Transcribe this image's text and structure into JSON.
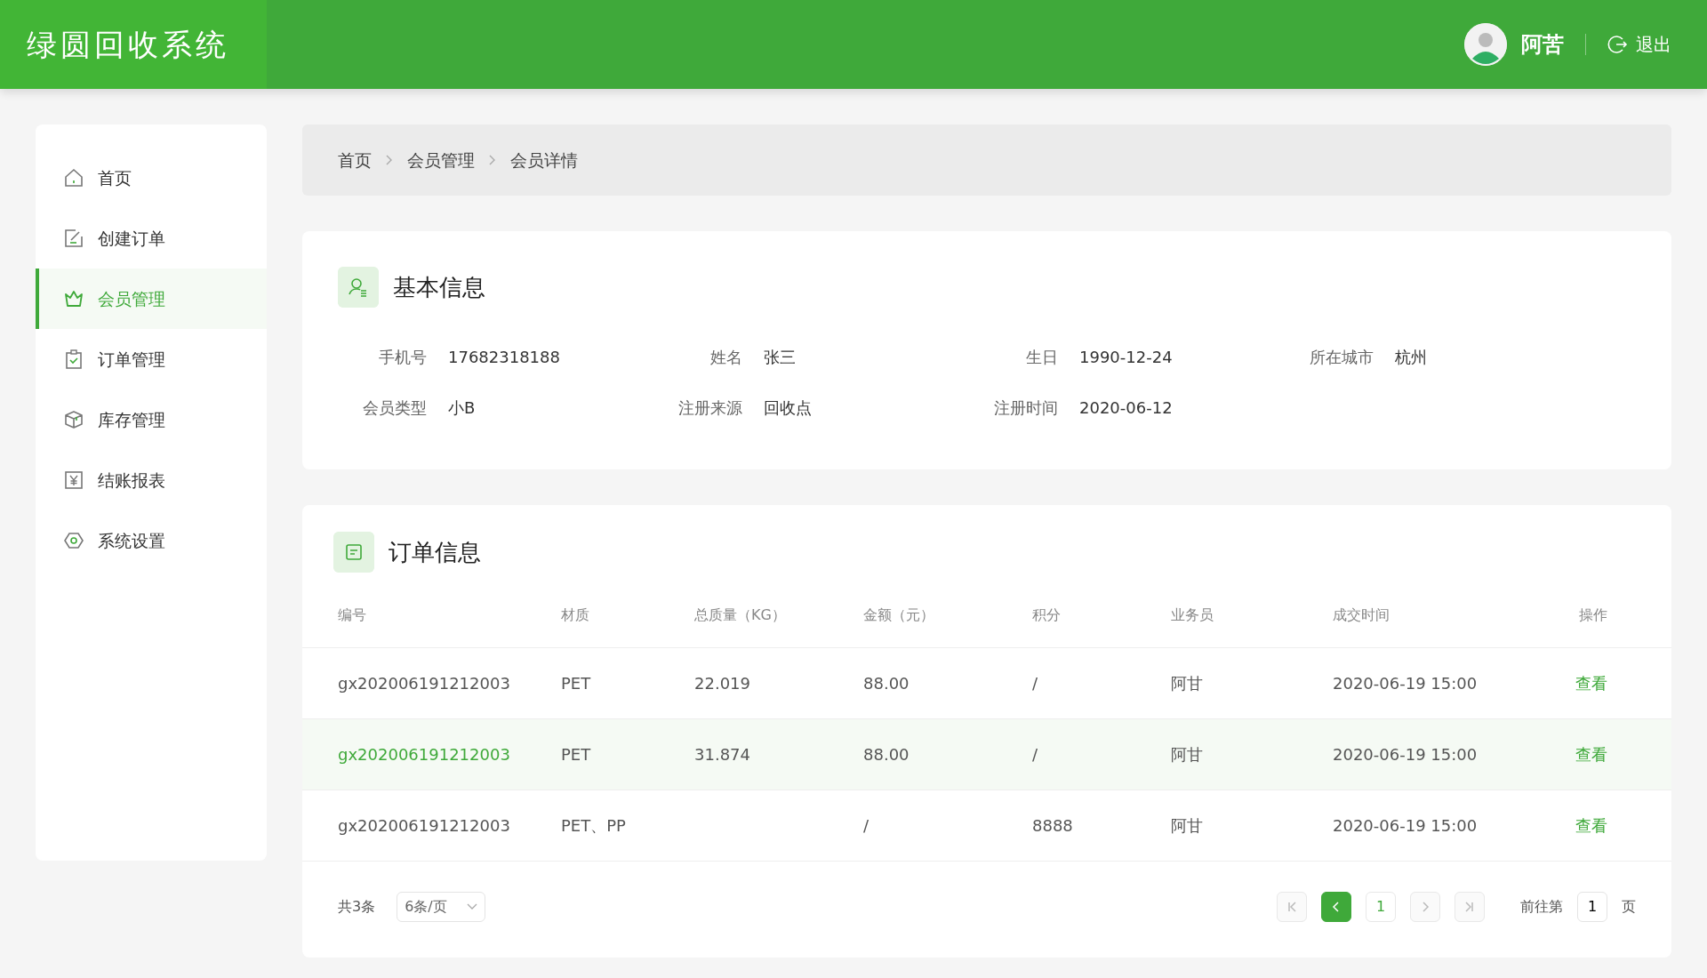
{
  "header": {
    "logo": "绿圆回收系统",
    "user_name": "阿苦",
    "logout": "退出"
  },
  "sidebar": {
    "items": [
      {
        "label": "首页",
        "selected": false
      },
      {
        "label": "创建订单",
        "selected": false
      },
      {
        "label": "会员管理",
        "selected": true
      },
      {
        "label": "订单管理",
        "selected": false
      },
      {
        "label": "库存管理",
        "selected": false
      },
      {
        "label": "结账报表",
        "selected": false
      },
      {
        "label": "系统设置",
        "selected": false
      }
    ]
  },
  "breadcrumb": [
    "首页",
    "会员管理",
    "会员详情"
  ],
  "basic_info": {
    "title": "基本信息",
    "fields": [
      {
        "label": "手机号",
        "value": "17682318188"
      },
      {
        "label": "姓名",
        "value": "张三"
      },
      {
        "label": "生日",
        "value": "1990-12-24"
      },
      {
        "label": "所在城市",
        "value": "杭州"
      },
      {
        "label": "会员类型",
        "value": "小B"
      },
      {
        "label": "注册来源",
        "value": "回收点"
      },
      {
        "label": "注册时间",
        "value": "2020-06-12"
      }
    ]
  },
  "orders": {
    "title": "订单信息",
    "columns": [
      "编号",
      "材质",
      "总质量（KG）",
      "金额（元）",
      "积分",
      "业务员",
      "成交时间",
      "操作"
    ],
    "rows": [
      {
        "selected": false,
        "cells": [
          "gx202006191212003",
          "PET",
          "22.019",
          "88.00",
          "/",
          "阿甘",
          "2020-06-19  15:00"
        ],
        "action": "查看"
      },
      {
        "selected": true,
        "cells": [
          "gx202006191212003",
          "PET",
          "31.874",
          "88.00",
          "/",
          "阿甘",
          "2020-06-19  15:00"
        ],
        "action": "查看"
      },
      {
        "selected": false,
        "cells": [
          "gx202006191212003",
          "PET、PP",
          "",
          "/",
          "8888",
          "阿甘",
          "2020-06-19  15:00"
        ],
        "action": "查看"
      }
    ],
    "total": "共3条",
    "page_size": "6条/页",
    "pager": [
      {
        "kind": "first",
        "disabled": true
      },
      {
        "kind": "prev",
        "disabled": false
      },
      {
        "kind": "page",
        "label": "1"
      },
      {
        "kind": "next",
        "disabled": true
      },
      {
        "kind": "last",
        "disabled": true
      }
    ],
    "goto_prefix": "前往第",
    "goto_value": "1",
    "goto_suffix": "页"
  }
}
